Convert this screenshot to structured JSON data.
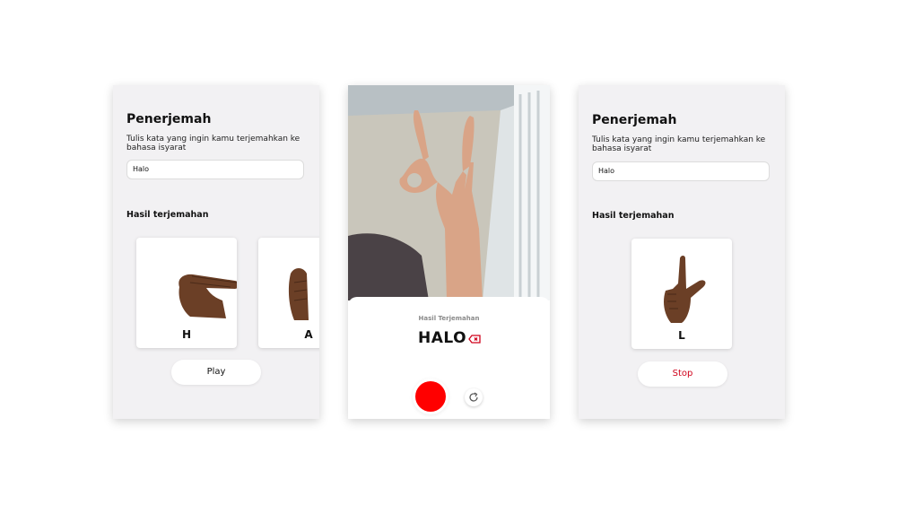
{
  "left_screen": {
    "title": "Penerjemah",
    "description": "Tulis kata yang ingin kamu terjemahkan ke bahasa isyarat",
    "input_value": "Halo",
    "result_heading": "Hasil terjemahan",
    "cards": [
      {
        "letter": "H",
        "icon": "hand-sign-h-icon"
      },
      {
        "letter": "A",
        "icon": "hand-sign-a-icon"
      }
    ],
    "action_label": "Play"
  },
  "middle_screen": {
    "result_label": "Hasil Terjemahan",
    "result_word": "HALO",
    "icons": [
      "backspace-icon",
      "record-button",
      "refresh-icon"
    ],
    "record_color": "#ff0000",
    "accent_color": "#d0021b"
  },
  "right_screen": {
    "title": "Penerjemah",
    "description": "Tulis kata yang ingin kamu terjemahkan ke bahasa isyarat",
    "input_value": "Halo",
    "result_heading": "Hasil terjemahan",
    "cards": [
      {
        "letter": "L",
        "icon": "hand-sign-l-icon"
      }
    ],
    "action_label": "Stop",
    "action_color": "#d0021b"
  }
}
